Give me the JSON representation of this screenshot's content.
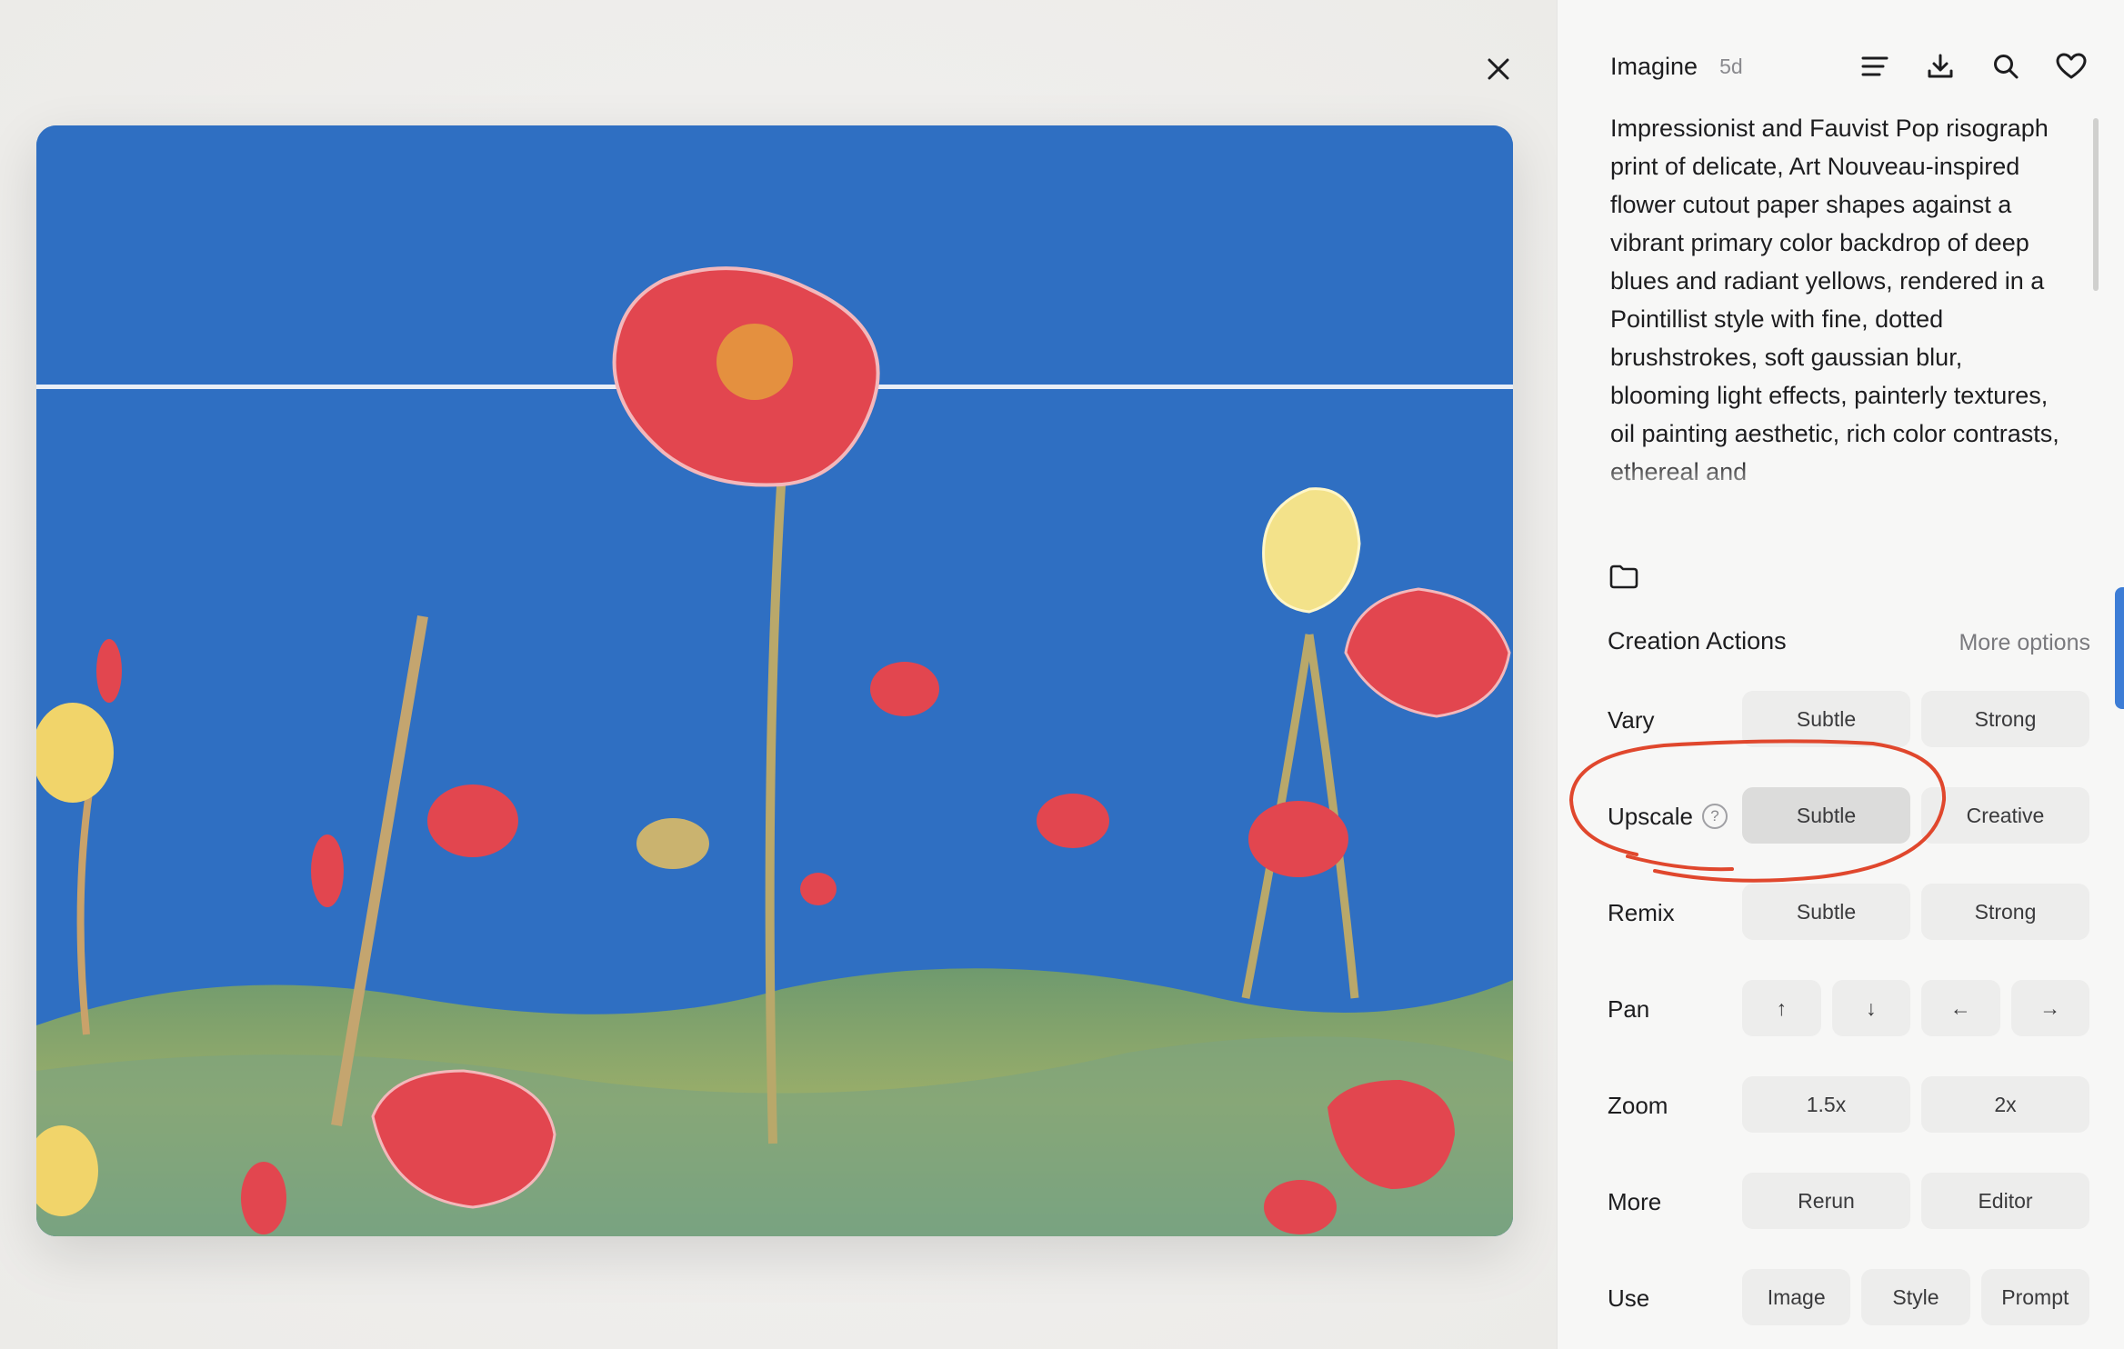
{
  "header": {
    "title": "Imagine",
    "age": "5d",
    "icons": [
      "list-icon",
      "download-icon",
      "search-icon",
      "heart-icon"
    ]
  },
  "prompt": {
    "text": "Impressionist and Fauvist Pop risograph print of delicate, Art Nouveau-inspired flower cutout paper shapes against a vibrant primary color backdrop of deep blues and radiant yellows, rendered in a Pointillist style with fine, dotted brushstrokes, soft gaussian blur, blooming light effects, painterly textures, oil painting aesthetic, rich color contrasts, ethereal and"
  },
  "actions": {
    "title": "Creation Actions",
    "more_options": "More options",
    "rows": [
      {
        "label": "Vary",
        "buttons": [
          "Subtle",
          "Strong"
        ]
      },
      {
        "label": "Upscale",
        "buttons": [
          "Subtle",
          "Creative"
        ],
        "active": 0
      },
      {
        "label": "Remix",
        "buttons": [
          "Subtle",
          "Strong"
        ]
      },
      {
        "label": "Pan",
        "buttons": [
          "↑",
          "↓",
          "←",
          "→"
        ]
      },
      {
        "label": "Zoom",
        "buttons": [
          "1.5x",
          "2x"
        ]
      },
      {
        "label": "More",
        "buttons": [
          "Rerun",
          "Editor"
        ]
      },
      {
        "label": "Use",
        "buttons": [
          "Image",
          "Style",
          "Prompt"
        ]
      }
    ]
  },
  "colors": {
    "sky": "#2f6fc2",
    "petal": "#e2464f",
    "yellow": "#f3e28a",
    "annotation": "#e0472d"
  }
}
